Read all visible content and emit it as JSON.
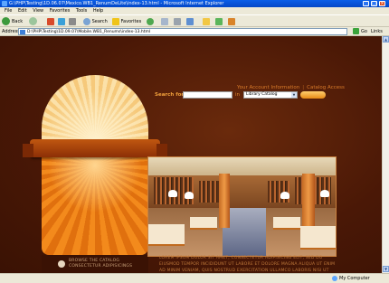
{
  "window": {
    "title": "G:\\PHP\\Testing\\1D.06.07\\Mexico.WB1_RenumDeLite\\index-13.html - Microsoft Internet Explorer"
  },
  "menu": [
    "File",
    "Edit",
    "View",
    "Favorites",
    "Tools",
    "Help"
  ],
  "toolbar": {
    "back_label": "Back",
    "search_label": "Search",
    "favorites_label": "Favorites"
  },
  "address": {
    "label": "Address",
    "value": "D:\\PHP\\Testing\\1D.09.07\\Mobile.WB1_Renums\\index-13.html",
    "go_label": "Go",
    "links_label": "Links"
  },
  "site": {
    "nav": {
      "account": "Your Account Information",
      "separator": "|",
      "catalog": "Catalog Access"
    },
    "search": {
      "label": "Search for:",
      "input_value": "",
      "in_label": "in",
      "catalog_selected": "Library Catalog"
    },
    "promo": {
      "line1": "BROWSE THE CATALOG",
      "line2": "CONSECTETUR ADIPISICINGS"
    },
    "lorem": "LOREM IPSUM DOLOR SIT AMET, CONSECTETUR ADIPISICING ELIT, SED DO EIUSMOD TEMPOR INCIDIDUNT UT LABORE ET DOLORE MAGNA ALIQUA UT ENIM AD MINIM VENIAM, QUIS NOSTRUD EXERCITATION ULLAMCO LABORIS NISI UT ALIQUIP EX EA"
  },
  "status": {
    "text": "",
    "zone": "My Computer"
  },
  "colors": {
    "page_bg": "#471806",
    "accent": "#f1a13c",
    "ribbon": "#a9420a"
  }
}
